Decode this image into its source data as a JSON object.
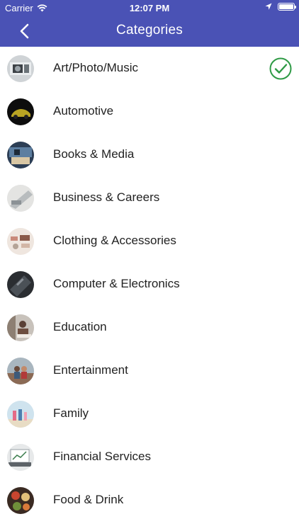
{
  "status": {
    "carrier": "Carrier",
    "time": "12:07 PM",
    "icons": [
      "wifi-icon",
      "location-icon",
      "battery-icon"
    ]
  },
  "nav": {
    "title": "Categories",
    "back_icon": "chevron-left-icon"
  },
  "colors": {
    "nav_bg": "#4a52b5",
    "check": "#2e9a45"
  },
  "categories": [
    {
      "label": "Art/Photo/Music",
      "selected": true
    },
    {
      "label": "Automotive",
      "selected": false
    },
    {
      "label": "Books & Media",
      "selected": false
    },
    {
      "label": "Business & Careers",
      "selected": false
    },
    {
      "label": "Clothing & Accessories",
      "selected": false
    },
    {
      "label": "Computer & Electronics",
      "selected": false
    },
    {
      "label": "Education",
      "selected": false
    },
    {
      "label": "Entertainment",
      "selected": false
    },
    {
      "label": "Family",
      "selected": false
    },
    {
      "label": "Financial Services",
      "selected": false
    },
    {
      "label": "Food & Drink",
      "selected": false
    }
  ]
}
